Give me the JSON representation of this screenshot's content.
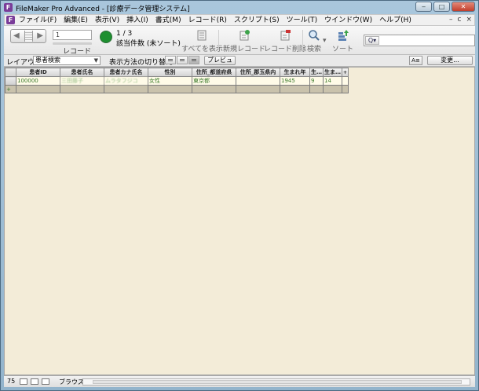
{
  "window": {
    "title": "FileMaker Pro Advanced - [診療データ管理システム]",
    "app_icon_letter": "F",
    "controls": {
      "minimize": "‒",
      "maximize": "□",
      "close": "✕"
    }
  },
  "menubar": {
    "items": [
      "ファイル(F)",
      "編集(E)",
      "表示(V)",
      "挿入(I)",
      "書式(M)",
      "レコード(R)",
      "スクリプト(S)",
      "ツール(T)",
      "ウインドウ(W)",
      "ヘルプ(H)"
    ],
    "doc_controls": [
      "–",
      "ⅽ",
      "×"
    ]
  },
  "toolbar": {
    "record_number": "1",
    "record_label": "レコード",
    "found_count": "1 / 3",
    "found_status": "該当件数 (未ソート)",
    "show_all": "すべてを表示",
    "new_record": "新規レコード",
    "delete_record": "レコード削除",
    "find": "検索",
    "sort": "ソート",
    "search_placeholder": ""
  },
  "layoutbar": {
    "layout_label": "レイアウト:",
    "layout_value": "患者検索",
    "view_label": "表示方法の切り替え:",
    "preview": "プレビュー",
    "text_format_btn": "A≡",
    "modify": "変更..."
  },
  "table": {
    "columns": [
      "患者ID",
      "患者氏名",
      "患者カナ氏名",
      "性別",
      "住所_都道府県",
      "住所_郡玉県内",
      "生まれ年",
      "生…",
      "生ま…"
    ],
    "rows": [
      [
        "100000",
        "三田藤子",
        "ムラタフジコ",
        "女性",
        "東京都",
        "",
        "1945",
        "9",
        "14"
      ]
    ],
    "add_col": "+",
    "new_row_marker": "+"
  },
  "statusbar": {
    "zoom": "75",
    "mode": "ブラウズ"
  }
}
